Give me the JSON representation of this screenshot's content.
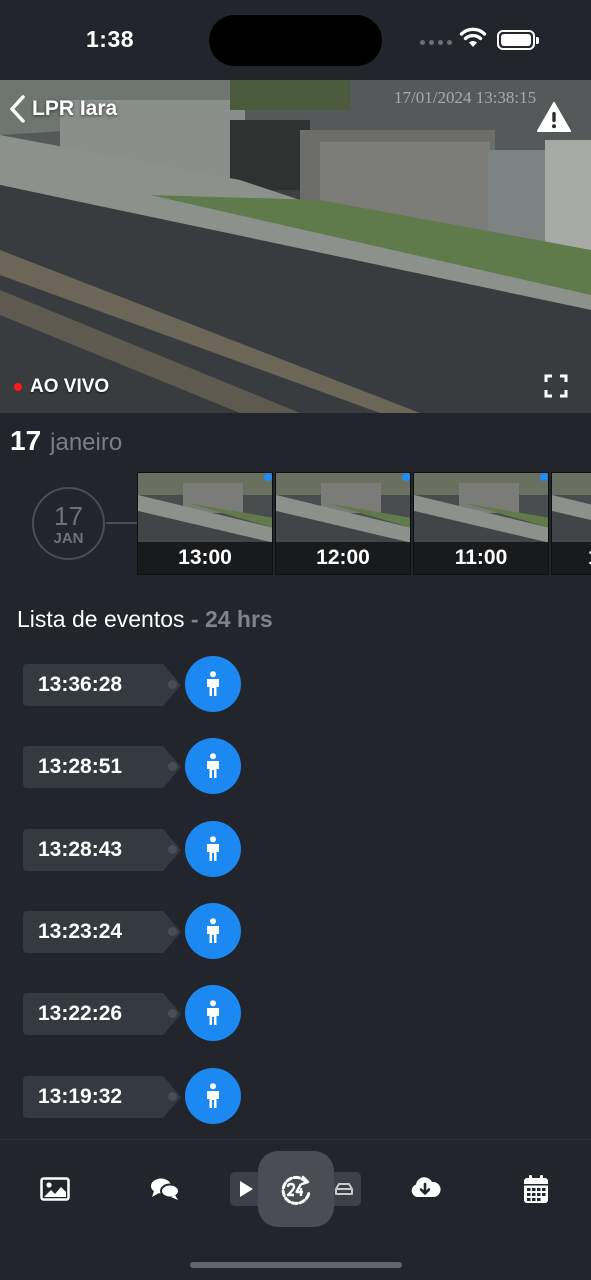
{
  "status_bar": {
    "time": "1:38"
  },
  "camera": {
    "title": "LPR Iara",
    "osd_timestamp": "17/01/2024 13:38:15",
    "live_label": "AO VIVO"
  },
  "date": {
    "day": "17",
    "month": "janeiro",
    "badge_day": "17",
    "badge_month": "JAN"
  },
  "timeline": {
    "thumbnails": [
      {
        "label": "13:00"
      },
      {
        "label": "12:00"
      },
      {
        "label": "11:00"
      },
      {
        "label": "1"
      }
    ]
  },
  "events": {
    "title": "Lista de eventos",
    "subtitle": " - 24 hrs",
    "items": [
      {
        "time": "13:36:28",
        "type": "person-icon"
      },
      {
        "time": "13:28:51",
        "type": "person-icon"
      },
      {
        "time": "13:28:43",
        "type": "person-icon"
      },
      {
        "time": "13:23:24",
        "type": "person-icon"
      },
      {
        "time": "13:22:26",
        "type": "person-icon"
      },
      {
        "time": "13:19:32",
        "type": "person-icon"
      }
    ]
  },
  "toolbar": {
    "items": [
      "gallery-icon",
      "chat-icon",
      "play-icon",
      "history-24h-icon",
      "car-icon",
      "cloud-download-icon",
      "calendar-icon"
    ],
    "active": "history-24h-icon"
  },
  "colors": {
    "background": "#22252b",
    "accent": "#1c88f2",
    "live": "#ff1a1a"
  }
}
